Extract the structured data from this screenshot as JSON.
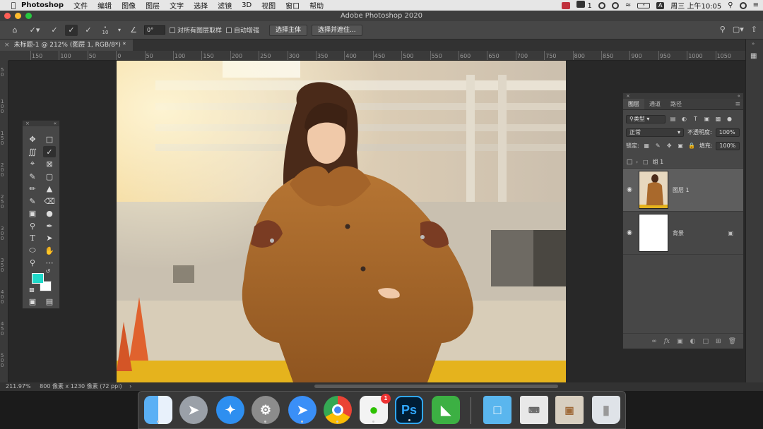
{
  "menubar": {
    "app_name": "Photoshop",
    "menus": [
      "文件",
      "编辑",
      "图像",
      "图层",
      "文字",
      "选择",
      "滤镜",
      "3D",
      "视图",
      "窗口",
      "帮助"
    ],
    "wechat_count": "1",
    "clock": "周三 上午10:05"
  },
  "window": {
    "title": "Adobe Photoshop 2020"
  },
  "options_bar": {
    "brush_size": "10",
    "angle": "0°",
    "sample_all_layers": "对所有图层取样",
    "auto_enhance": "自动增强",
    "select_subject": "选择主体",
    "select_and_mask": "选择并遮住..."
  },
  "document": {
    "tab_title": "未标题-1 @ 212% (图层 1, RGB/8*) *",
    "close": "×"
  },
  "ruler": {
    "h_ticks": [
      "150",
      "100",
      "50",
      "0",
      "50",
      "100",
      "150",
      "200",
      "250",
      "300",
      "350",
      "400",
      "450",
      "500",
      "550",
      "600",
      "650",
      "700",
      "750",
      "800",
      "850",
      "900",
      "950",
      "1000",
      "1050"
    ],
    "v_ticks": [
      "5 0",
      "1 0 0",
      "1 5 0",
      "2 0 0",
      "2 5 0",
      "3 0 0",
      "3 5 0",
      "4 0 0",
      "4 5 0",
      "5 0 0"
    ]
  },
  "layers_panel": {
    "tabs": [
      "图层",
      "通道",
      "路径"
    ],
    "filter_kind": "类型",
    "blend_mode": "正常",
    "opacity_label": "不透明度:",
    "opacity_value": "100%",
    "lock_label": "锁定:",
    "fill_label": "填充:",
    "fill_value": "100%",
    "layers": [
      {
        "name": "组 1",
        "type": "group"
      },
      {
        "name": "图层 1",
        "type": "pixel",
        "selected": true
      },
      {
        "name": "背景",
        "type": "background",
        "locked": true
      }
    ]
  },
  "status_bar": {
    "zoom": "211.97%",
    "doc_info": "800 像素 x 1230 像素 (72 ppi)"
  },
  "colors": {
    "foreground": "#1fd9c9",
    "background": "#ffffff"
  },
  "dock": {
    "apps": [
      "Finder",
      "Launchpad",
      "Safari",
      "系统偏好设置",
      "Feishu",
      "Chrome",
      "微信",
      "Photoshop",
      "Camtasia",
      "Folder",
      "Screenshot",
      "Screenshot 2",
      "Trash"
    ],
    "photoshop_label": "Ps",
    "wechat_badge": "1"
  }
}
